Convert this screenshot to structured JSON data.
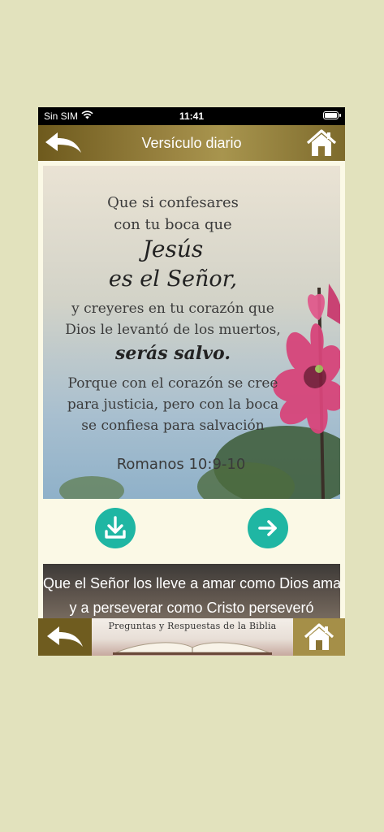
{
  "status": {
    "carrier": "Sin SIM",
    "time": "11:41"
  },
  "nav": {
    "title": "Versículo diario"
  },
  "verse": {
    "lines": [
      "Que si confesares",
      "con tu boca que",
      "Jesús",
      "es el Señor,",
      "y creyeres en tu corazón que",
      "Dios le levantó de los muertos,",
      "serás salvo.",
      "Porque con el corazón se cree",
      "para justicia, pero con la boca",
      "se confiesa para salvación"
    ],
    "reference": "Romanos 10:9-10"
  },
  "banner": {
    "line1": "Que el Señor los lleve a amar como Dios ama,",
    "line2": "y a perseverar como Cristo perseveró"
  },
  "bottom": {
    "bible_title": "Preguntas y Respuestas de la Biblia"
  },
  "colors": {
    "accent": "#1fb6a3",
    "bar_dark": "#6e5a1d",
    "bar_light": "#a8954e",
    "background": "#e2e2bd"
  },
  "icons": [
    "wifi-icon",
    "battery-icon",
    "back-arrow-icon",
    "home-icon",
    "download-icon",
    "arrow-right-icon",
    "open-book-icon",
    "flower-image"
  ]
}
